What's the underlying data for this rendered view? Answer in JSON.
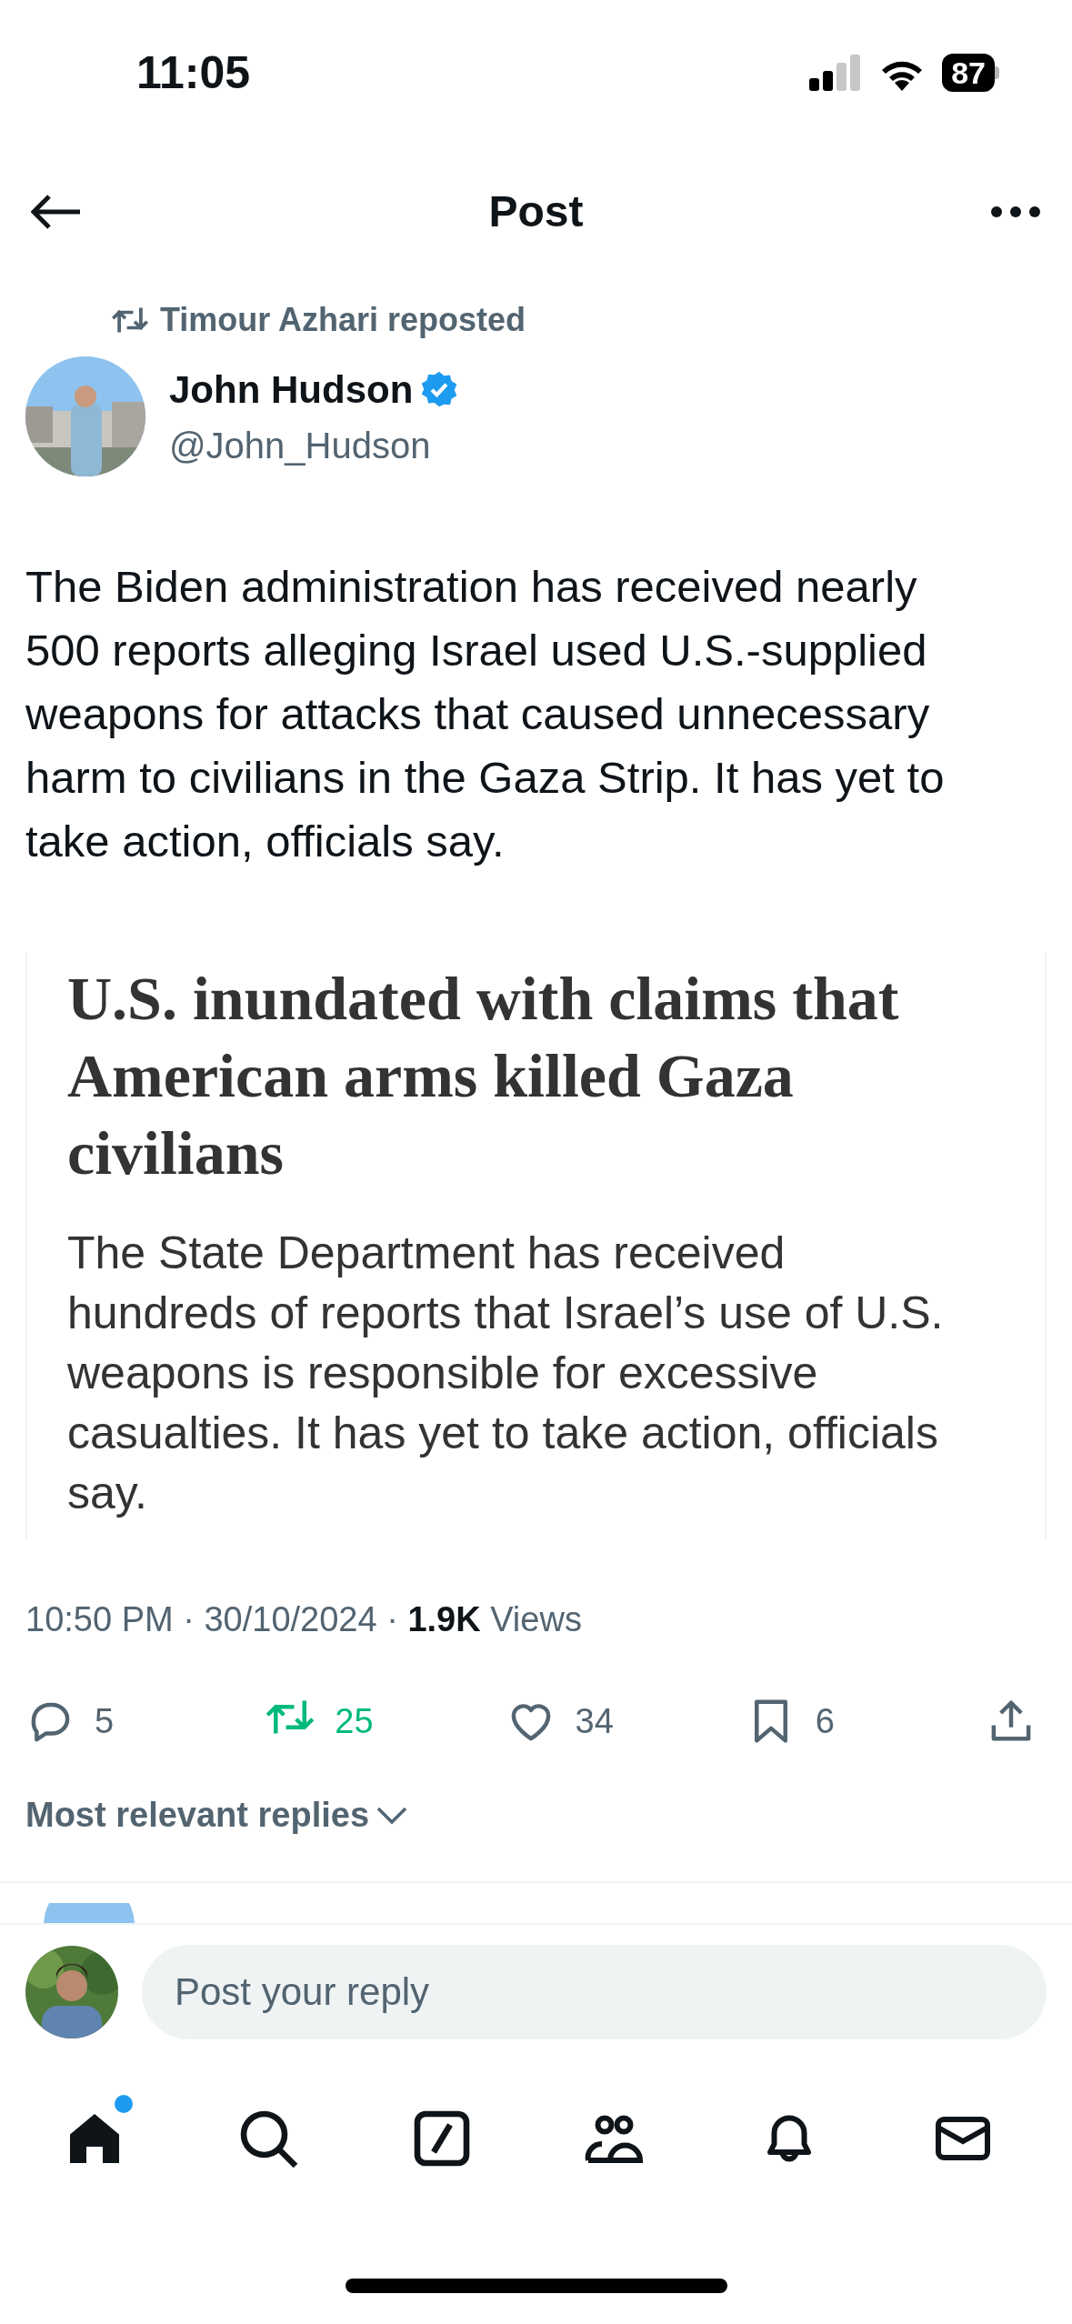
{
  "status_bar": {
    "time": "11:05",
    "battery": "87"
  },
  "header": {
    "title": "Post"
  },
  "repost": {
    "text": "Timour Azhari reposted"
  },
  "author": {
    "name": "John Hudson",
    "verified": true,
    "handle": "@John_Hudson"
  },
  "post": {
    "text": "The Biden administration has received nearly 500 reports alleging Israel used U.S.-supplied weapons for attacks that caused unnecessary harm to civilians in the Gaza Strip. It has yet to take action, officials say.",
    "card": {
      "headline": "U.S. inundated with claims that American arms killed Gaza civilians",
      "summary": "The State Department has received hundreds of reports that Israel’s use of U.S. weapons is responsible for excessive casualties. It has yet to take action, officials say."
    },
    "metadata": "10:50 PM · 30/10/2024 · **1.9K** Views"
  },
  "actions": [
    {
      "kind": "reply",
      "count": "5",
      "active": false
    },
    {
      "kind": "repost",
      "count": "25",
      "active": true
    },
    {
      "kind": "like",
      "count": "34",
      "active": false
    },
    {
      "kind": "bookmark",
      "count": "6",
      "active": false
    },
    {
      "kind": "share",
      "active": false
    }
  ],
  "replies_sort": {
    "label": "Most relevant replies"
  },
  "composer": {
    "placeholder": "Post your reply"
  },
  "tab_bar": [
    {
      "kind": "home",
      "selected": true,
      "badge": true
    },
    {
      "kind": "search",
      "selected": false,
      "badge": false
    },
    {
      "kind": "grok",
      "selected": false,
      "badge": false
    },
    {
      "kind": "communities",
      "selected": false,
      "badge": false
    },
    {
      "kind": "notifications",
      "selected": false,
      "badge": false
    },
    {
      "kind": "messages",
      "selected": false,
      "badge": false
    }
  ]
}
